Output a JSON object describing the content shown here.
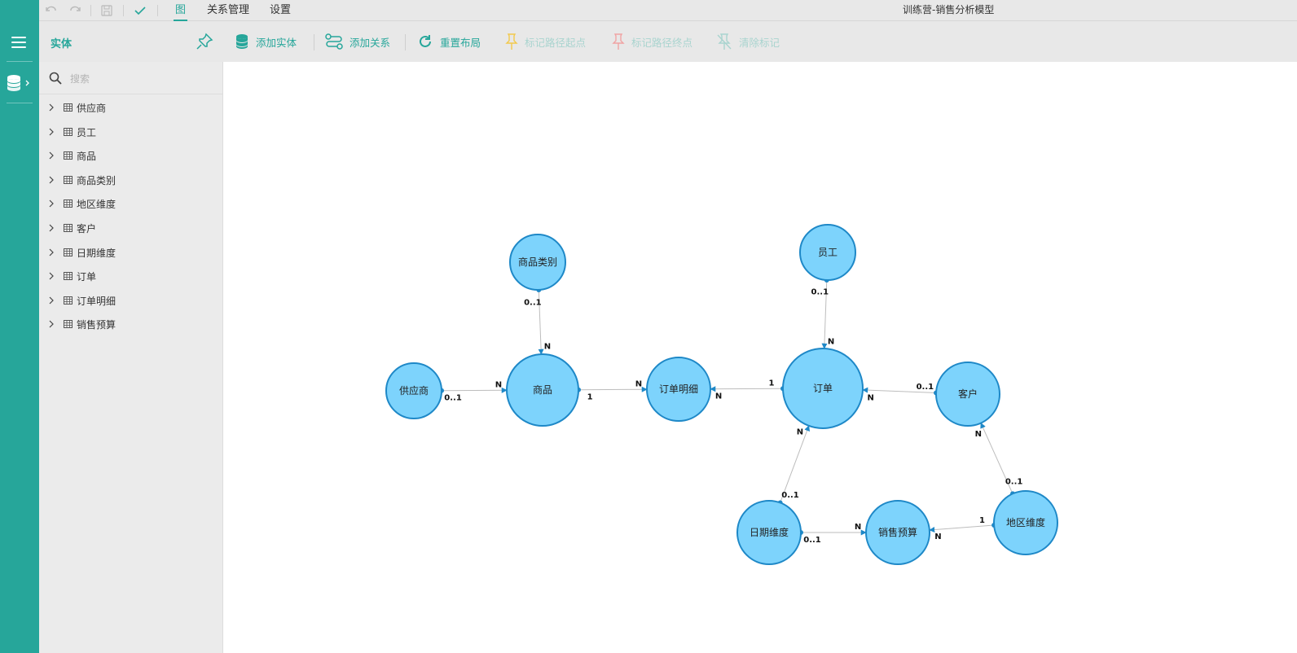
{
  "window": {
    "title": "训练营-销售分析模型"
  },
  "top_tabs": [
    {
      "label": "图",
      "active": true
    },
    {
      "label": "关系管理",
      "active": false
    },
    {
      "label": "设置",
      "active": false
    }
  ],
  "toolbar": {
    "panel_title": "实体",
    "add_entity": "添加实体",
    "add_relation": "添加关系",
    "reset_layout": "重置布局",
    "mark_start": "标记路径起点",
    "mark_end": "标记路径终点",
    "clear_marks": "清除标记"
  },
  "search": {
    "placeholder": "搜索",
    "value": ""
  },
  "entities": [
    "供应商",
    "员工",
    "商品",
    "商品类别",
    "地区维度",
    "客户",
    "日期维度",
    "订单",
    "订单明细",
    "销售预算"
  ],
  "diagram": {
    "nodes": [
      {
        "id": "category",
        "label": "商品类别"
      },
      {
        "id": "supplier",
        "label": "供应商"
      },
      {
        "id": "product",
        "label": "商品"
      },
      {
        "id": "order_detail",
        "label": "订单明细"
      },
      {
        "id": "employee",
        "label": "员工"
      },
      {
        "id": "order",
        "label": "订单"
      },
      {
        "id": "customer",
        "label": "客户"
      },
      {
        "id": "date",
        "label": "日期维度"
      },
      {
        "id": "budget",
        "label": "销售预算"
      },
      {
        "id": "region",
        "label": "地区维度"
      }
    ],
    "edges": [
      {
        "from": "category",
        "to": "product",
        "from_card": "0..1",
        "to_card": "N"
      },
      {
        "from": "supplier",
        "to": "product",
        "from_card": "0..1",
        "to_card": "N"
      },
      {
        "from": "product",
        "to": "order_detail",
        "from_card": "1",
        "to_card": "N"
      },
      {
        "from": "order",
        "to": "order_detail",
        "from_card": "1",
        "to_card": "N"
      },
      {
        "from": "employee",
        "to": "order",
        "from_card": "0..1",
        "to_card": "N"
      },
      {
        "from": "customer",
        "to": "order",
        "from_card": "0..1",
        "to_card": "N"
      },
      {
        "from": "date",
        "to": "order",
        "from_card": "0..1",
        "to_card": "N"
      },
      {
        "from": "region",
        "to": "customer",
        "from_card": "0..1",
        "to_card": "N"
      },
      {
        "from": "date",
        "to": "budget",
        "from_card": "0..1",
        "to_card": "N"
      },
      {
        "from": "region",
        "to": "budget",
        "from_card": "1",
        "to_card": "N"
      }
    ]
  },
  "colors": {
    "accent": "#26a69a",
    "node_fill": "#7dd3fc",
    "node_stroke": "#1e88c7",
    "mark_start": "#f2c94c",
    "mark_end": "#f0a3a3"
  },
  "icons": {
    "undo": "undo-icon",
    "redo": "redo-icon",
    "save": "save-icon",
    "check": "check-icon",
    "menu": "menu-icon",
    "database": "database-icon",
    "pin": "pin-icon",
    "search": "search-icon"
  }
}
